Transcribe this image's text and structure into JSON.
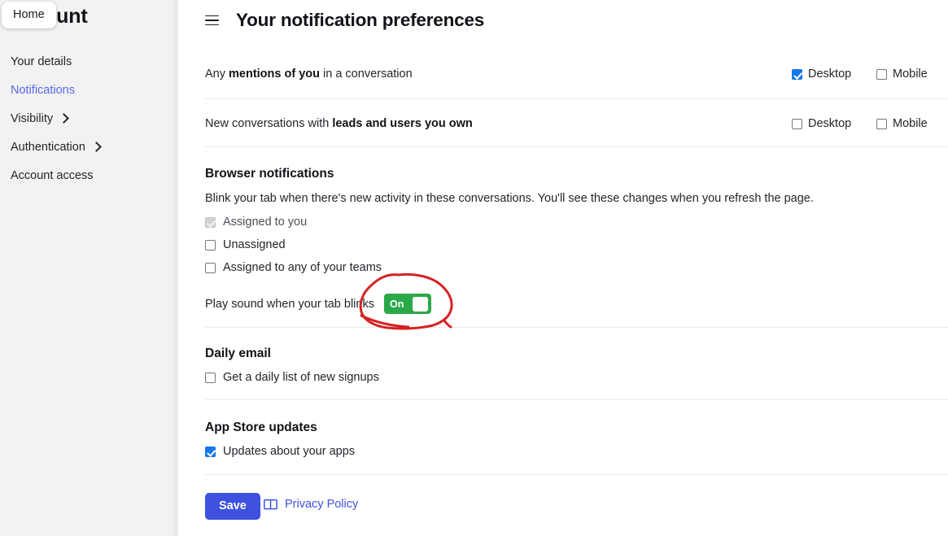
{
  "sidebar": {
    "tooltip": "Home",
    "title": "account",
    "items": [
      {
        "label": "Your details",
        "active": false,
        "chevron": false
      },
      {
        "label": "Notifications",
        "active": true,
        "chevron": false
      },
      {
        "label": "Visibility",
        "active": false,
        "chevron": true
      },
      {
        "label": "Authentication",
        "active": false,
        "chevron": true
      },
      {
        "label": "Account access",
        "active": false,
        "chevron": false
      }
    ]
  },
  "header": {
    "menu_icon": "hamburger-menu-icon",
    "title": "Your notification preferences"
  },
  "preference_rows": [
    {
      "label_prefix": "Any ",
      "label_bold": "mentions of you",
      "label_suffix": " in a conversation",
      "desktop_label": "Desktop",
      "desktop_checked": true,
      "mobile_label": "Mobile",
      "mobile_checked": false
    },
    {
      "label_prefix": "New conversations with ",
      "label_bold": "leads and users you own",
      "label_suffix": "",
      "desktop_label": "Desktop",
      "desktop_checked": false,
      "mobile_label": "Mobile",
      "mobile_checked": false
    }
  ],
  "browser_notifications": {
    "heading": "Browser notifications",
    "description": "Blink your tab when there's new activity in these conversations. You'll see these changes when you refresh the page.",
    "options": [
      {
        "label": "Assigned to you",
        "state": "disabled-checked"
      },
      {
        "label": "Unassigned",
        "state": "unchecked"
      },
      {
        "label": "Assigned to any of your teams",
        "state": "unchecked"
      }
    ],
    "sound_label": "Play sound when your tab blinks",
    "sound_toggle_label": "On",
    "sound_toggle_on": true
  },
  "daily_email": {
    "heading": "Daily email",
    "option_label": "Get a daily list of new signups",
    "option_checked": false
  },
  "app_store_updates": {
    "heading": "App Store updates",
    "option_label": "Updates about your apps",
    "option_checked": true
  },
  "footer": {
    "save_label": "Save",
    "privacy_label": "Privacy Policy",
    "privacy_icon": "book-icon"
  },
  "annotation": {
    "shape": "hand-drawn-red-circle",
    "color": "#d42222",
    "target": "sound-toggle"
  },
  "colors": {
    "accent_blue": "#3f51e0",
    "checkbox_blue": "#1577e8",
    "toggle_green": "#2ba84a",
    "link_blue": "#5a67e8",
    "sidebar_bg": "#f2f2f2",
    "annotation_red": "#d42222"
  }
}
